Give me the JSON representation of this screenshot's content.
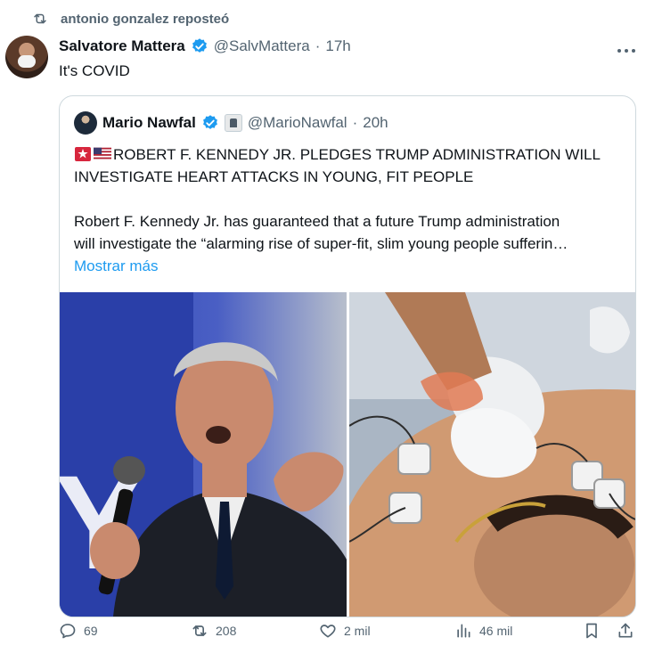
{
  "repost": {
    "text": "antonio gonzalez reposteó",
    "icon": "repost-icon"
  },
  "tweet": {
    "author_name": "Salvatore Mattera",
    "handle": "@SalvMattera",
    "separator": "·",
    "time": "17h",
    "text": "It's COVID",
    "more_icon": "more-options-icon"
  },
  "quote": {
    "author_name": "Mario Nawfal",
    "handle": "@MarioNawfal",
    "separator": "·",
    "time": "20h",
    "title": "ROBERT F. KENNEDY JR. PLEDGES TRUMP ADMINISTRATION WILL INVESTIGATE HEART ATTACKS IN YOUNG, FIT PEOPLE",
    "title_emojis": [
      "siren-emoji",
      "us-flag-emoji"
    ],
    "body_line1": "Robert F. Kennedy Jr. has guaranteed that a future Trump administration",
    "body_line2": "will investigate the “alarming rise of super-fit, slim young people sufferin…",
    "show_more": "Mostrar más",
    "images": [
      "speaker-with-microphone-photo",
      "cpr-on-patient-photo"
    ]
  },
  "actions": {
    "replies": "69",
    "reposts": "208",
    "likes": "2 mil",
    "views": "46 mil"
  },
  "colors": {
    "accent": "#1d9bf0",
    "muted": "#536471",
    "text": "#0f1419",
    "border": "#cfd9de"
  }
}
